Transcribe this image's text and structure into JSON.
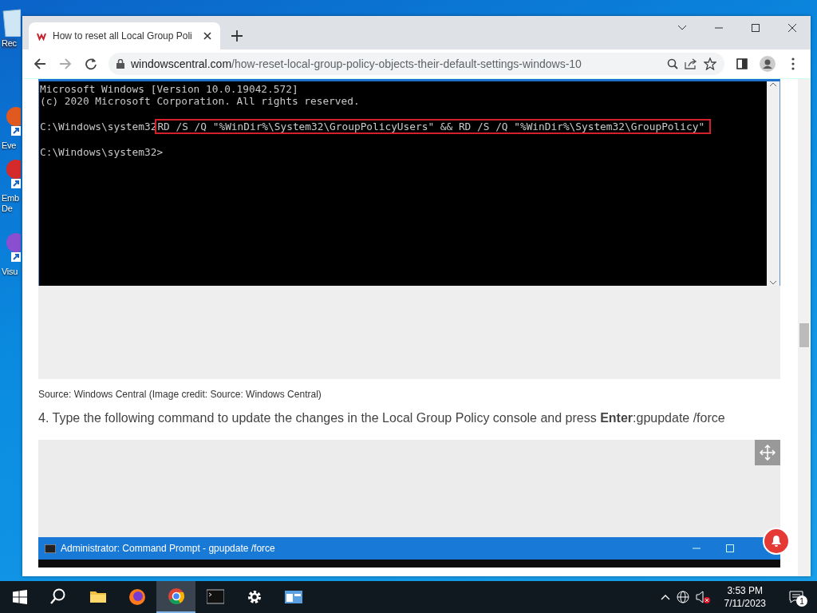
{
  "desktop_icons": [
    {
      "lines": [
        "Rec"
      ],
      "kind": "bin"
    },
    {
      "lines": [
        "Eve"
      ],
      "kind": "shortcut"
    },
    {
      "lines": [
        "Emb",
        "De"
      ],
      "kind": "shortcut"
    },
    {
      "lines": [
        "Visu"
      ],
      "kind": "shortcut"
    }
  ],
  "browser": {
    "tab": {
      "title": "How to reset all Local Group Poli",
      "selected": true
    },
    "address": {
      "domain": "windowscentral.com",
      "path": "/how-reset-local-group-policy-objects-their-default-settings-windows-10"
    }
  },
  "article": {
    "terminal": {
      "lines": [
        "Microsoft Windows [Version 10.0.19042.572]",
        "(c) 2020 Microsoft Corporation. All rights reserved."
      ],
      "prompt": "C:\\Windows\\system32",
      "command": "RD /S /Q \"%WinDir%\\System32\\GroupPolicyUsers\" && RD /S /Q \"%WinDir%\\System32\\GroupPolicy\"",
      "last_prompt": "C:\\Windows\\system32>"
    },
    "caption": "Source: Windows Central (Image credit: Source: Windows Central)",
    "step": "4. Type the following command to update the changes in the Local Group Policy console and press **Enter**:gpupdate /force",
    "second_window_title": "Administrator: Command Prompt - gpupdate  /force"
  },
  "taskbar": {
    "apps": [
      {
        "kind": "search",
        "active": false
      },
      {
        "kind": "folder",
        "active": false
      },
      {
        "kind": "firefox",
        "active": false
      },
      {
        "kind": "chrome",
        "active": true
      },
      {
        "kind": "terminal",
        "active": false
      },
      {
        "kind": "settings",
        "active": false
      },
      {
        "kind": "window",
        "active": false
      }
    ],
    "time": "3:53 PM",
    "date": "7/11/2023",
    "notifications": "1"
  }
}
